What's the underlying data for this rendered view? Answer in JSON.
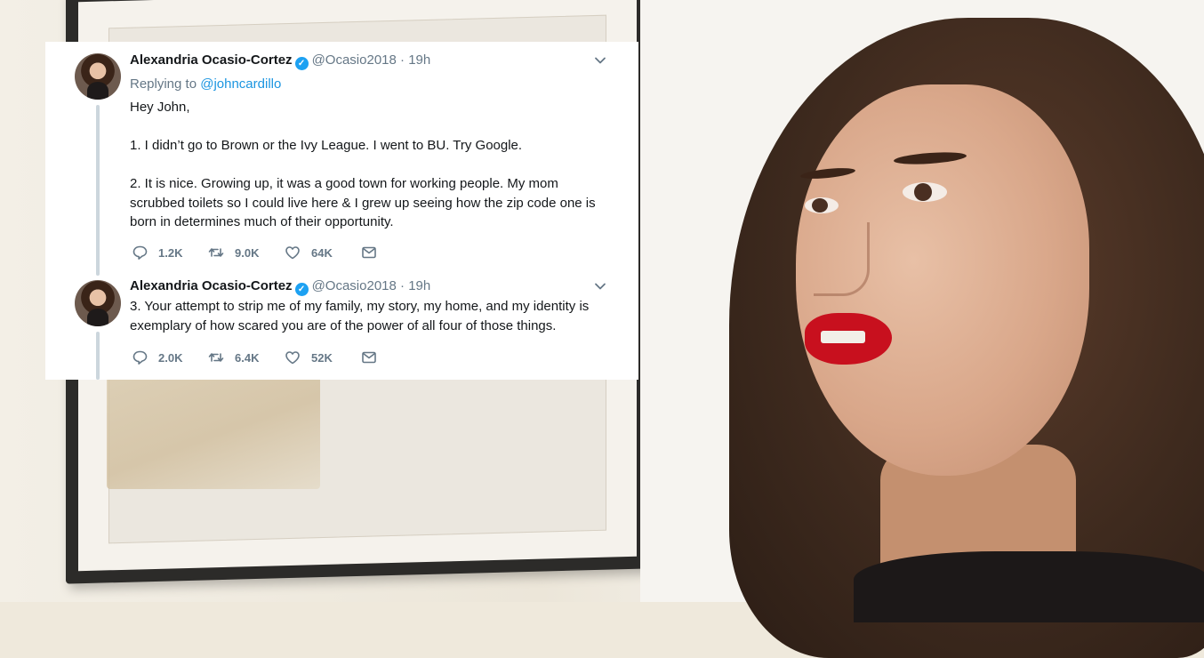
{
  "tweets": [
    {
      "display_name": "Alexandria Ocasio-Cortez",
      "verified_icon": "verified-badge-icon",
      "handle": "@Ocasio2018",
      "separator": "·",
      "time": "19h",
      "replying_label": "Replying to",
      "replying_to": "@johncardillo",
      "paragraphs": [
        "Hey John,",
        "1. I didn’t go to Brown or the Ivy League. I went to BU. Try Google.",
        "2. It is nice. Growing up, it was a good town for working people. My mom scrubbed toilets so I could live here & I grew up seeing how the zip code one is born in determines much of their opportunity."
      ],
      "replies": "1.2K",
      "retweets": "9.0K",
      "likes": "64K"
    },
    {
      "display_name": "Alexandria Ocasio-Cortez",
      "verified_icon": "verified-badge-icon",
      "handle": "@Ocasio2018",
      "separator": "·",
      "time": "19h",
      "paragraphs": [
        "3. Your attempt to strip me of my family, my story, my home, and my identity is exemplary of how scared you are of the power of all four of those things."
      ],
      "replies": "2.0K",
      "retweets": "6.4K",
      "likes": "52K"
    }
  ],
  "icons": {
    "reply": "reply-bubble-icon",
    "retweet": "retweet-icon",
    "like": "heart-icon",
    "dm": "envelope-icon",
    "menu": "chevron-down-icon"
  },
  "colors": {
    "link": "#1b95e0",
    "verified": "#1da1f2",
    "muted": "#657786",
    "text": "#14171a",
    "thread_line": "#ccd6dd",
    "lips": "#c8101e"
  }
}
